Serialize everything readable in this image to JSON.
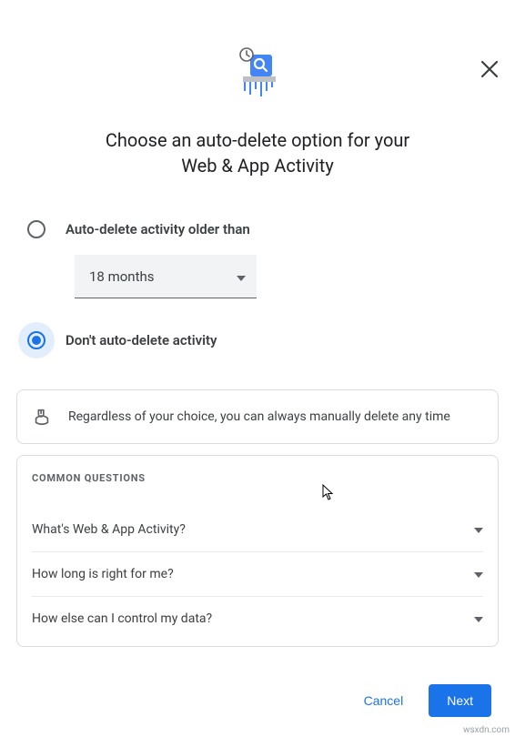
{
  "title_line1": "Choose an auto-delete option for your",
  "title_line2": "Web & App Activity",
  "options": {
    "older_than_label": "Auto-delete activity older than",
    "dont_delete_label": "Don't auto-delete activity",
    "selected": "dont",
    "dropdown_value": "18 months"
  },
  "info_text": "Regardless of your choice, you can always manually delete any time",
  "faq": {
    "header": "COMMON QUESTIONS",
    "items": [
      "What's Web & App Activity?",
      "How long is right for me?",
      "How else can I control my data?"
    ]
  },
  "footer": {
    "cancel": "Cancel",
    "next": "Next"
  },
  "watermark": "wsxdn.com"
}
